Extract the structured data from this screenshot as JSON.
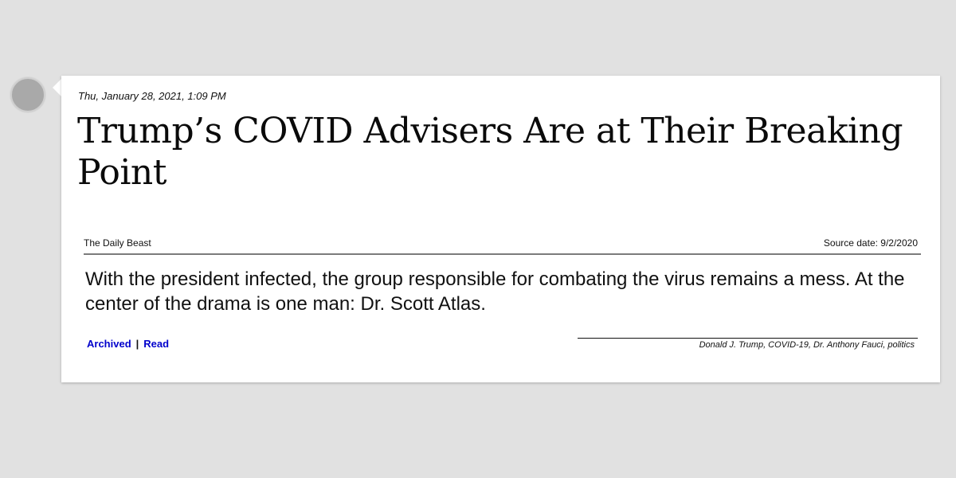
{
  "entry": {
    "timestamp": "Thu, January 28, 2021, 1:09 PM",
    "headline": "Trump’s COVID Advisers Are at Their Breaking Point",
    "source_name": "The Daily Beast",
    "source_date": "Source date: 9/2/2020",
    "summary": "With the president infected, the group responsible for combating the virus remains a mess. At the center of the drama is one man: Dr. Scott Atlas.",
    "links": {
      "archived": "Archived",
      "separator": "|",
      "read": "Read"
    },
    "tags": "Donald J. Trump, COVID-19, Dr. Anthony Fauci, politics"
  },
  "colors": {
    "background": "#e1e1e1",
    "card": "#ffffff",
    "link": "#0000cc",
    "dot": "#a9a9a9"
  }
}
